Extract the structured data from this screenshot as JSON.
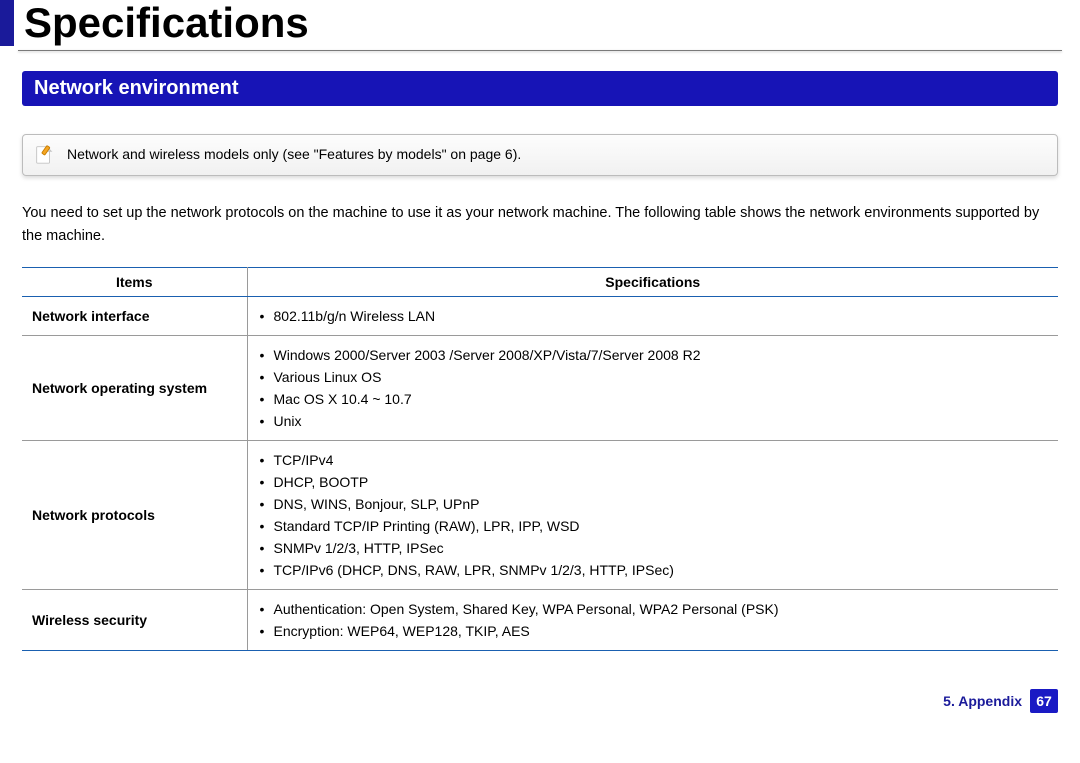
{
  "page_title": "Specifications",
  "section_heading": "Network environment",
  "note_text": "Network and wireless models only (see \"Features by models\" on page 6).",
  "intro_text": "You need to set up the network protocols on the machine to use it as your network machine. The following table shows the network environments supported by the machine.",
  "table": {
    "headers": {
      "items": "Items",
      "specs": "Specifications"
    },
    "rows": [
      {
        "item": "Network interface",
        "specs": [
          "802.11b/g/n Wireless LAN"
        ]
      },
      {
        "item": "Network operating system",
        "specs": [
          "Windows 2000/Server 2003 /Server 2008/XP/Vista/7/Server 2008 R2",
          "Various Linux OS",
          "Mac OS X 10.4 ~ 10.7",
          "Unix"
        ]
      },
      {
        "item": "Network protocols",
        "specs": [
          "TCP/IPv4",
          "DHCP, BOOTP",
          "DNS, WINS, Bonjour, SLP, UPnP",
          "Standard TCP/IP Printing (RAW), LPR, IPP, WSD",
          "SNMPv 1/2/3, HTTP, IPSec",
          "TCP/IPv6 (DHCP, DNS, RAW, LPR, SNMPv 1/2/3, HTTP, IPSec)"
        ]
      },
      {
        "item": "Wireless security",
        "specs": [
          "Authentication: Open System, Shared Key, WPA Personal, WPA2 Personal (PSK)",
          "Encryption: WEP64, WEP128, TKIP, AES"
        ]
      }
    ]
  },
  "footer": {
    "chapter": "5. Appendix",
    "page": "67"
  }
}
